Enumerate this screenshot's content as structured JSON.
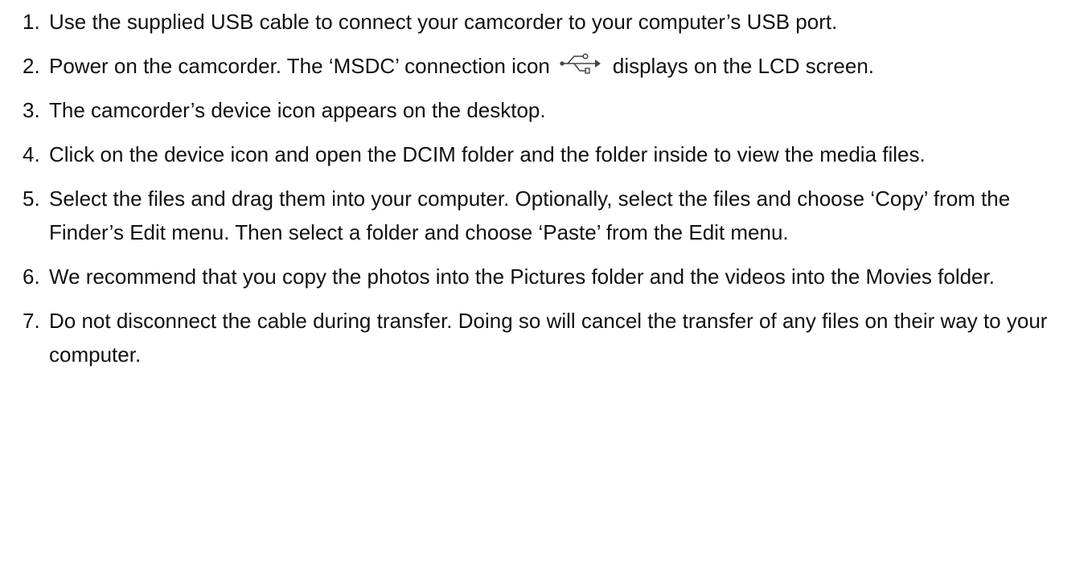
{
  "steps": [
    {
      "number": "1.",
      "text": "Use the supplied USB cable to connect your camcorder to your computer’s USB port."
    },
    {
      "number": "2.",
      "text_before": "Power on the camcorder. The ‘MSDC’ connection icon",
      "icon": "usb-icon",
      "text_after": "displays on the LCD screen."
    },
    {
      "number": "3.",
      "text": "The camcorder’s device icon appears on the desktop."
    },
    {
      "number": "4.",
      "text": "Click on the device icon and open the DCIM folder and the folder inside to view the media files."
    },
    {
      "number": "5.",
      "text": "Select the files and drag them into your computer. Optionally, select the files and choose ‘Copy’ from the Finder’s Edit menu. Then select a folder and choose ‘Paste’ from the Edit menu."
    },
    {
      "number": "6.",
      "text": "We recommend that you copy the photos into the Pictures folder and the videos into the Movies folder."
    },
    {
      "number": "7.",
      "text": "Do not disconnect the cable during transfer. Doing so will cancel the transfer of any files on their way to your computer."
    }
  ]
}
